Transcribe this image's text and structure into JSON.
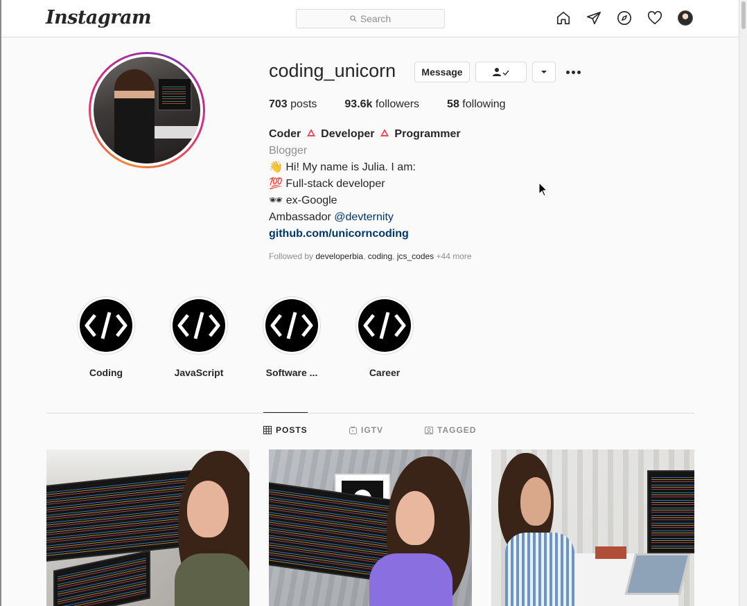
{
  "header": {
    "logo": "Instagram",
    "search_placeholder": "Search",
    "nav_icons": [
      "home-icon",
      "direct-icon",
      "explore-icon",
      "activity-heart-icon",
      "profile-avatar"
    ]
  },
  "profile": {
    "username": "coding_unicorn",
    "message_label": "Message",
    "stats": {
      "posts_count": "703",
      "posts_label": "posts",
      "followers_count": "93.6k",
      "followers_label": "followers",
      "following_count": "58",
      "following_label": "following"
    },
    "bio": {
      "title_parts": [
        "Coder",
        "Developer",
        "Programmer"
      ],
      "category": "Blogger",
      "line1": "👋 Hi! My name is Julia. I am:",
      "line2": "💯 Full-stack developer",
      "line3": "🕶 ex-Google",
      "ambassador_prefix": "Ambassador",
      "ambassador_mention": "@devternity",
      "link": "github.com/unicorncoding"
    },
    "followed_by": {
      "prefix": "Followed by",
      "names": [
        "developerbia",
        "coding",
        "jcs_codes"
      ],
      "more": "+44 more"
    }
  },
  "highlights": [
    {
      "label": "Coding"
    },
    {
      "label": "JavaScript"
    },
    {
      "label": "Software ..."
    },
    {
      "label": "Career"
    }
  ],
  "tabs": [
    {
      "label": "POSTS",
      "active": true
    },
    {
      "label": "IGTV",
      "active": false
    },
    {
      "label": "TAGGED",
      "active": false
    }
  ],
  "colors": {
    "accent_link": "#00376b",
    "border": "#dbdbdb",
    "text": "#262626",
    "muted": "#8e8e8e"
  }
}
